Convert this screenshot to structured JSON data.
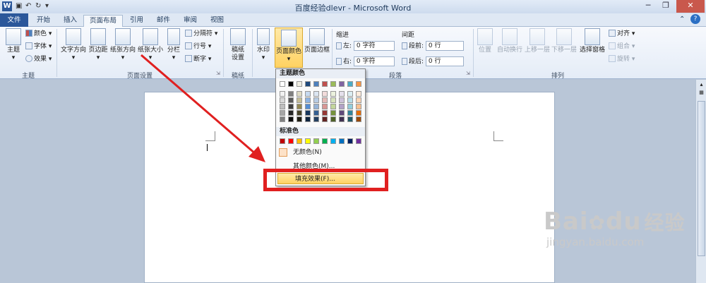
{
  "window": {
    "app_icon": "W",
    "title": "百度经验dlevr - Microsoft Word",
    "controls": [
      "─",
      "❐",
      "✕"
    ]
  },
  "tabs": [
    "文件",
    "开始",
    "插入",
    "页面布局",
    "引用",
    "邮件",
    "审阅",
    "视图"
  ],
  "ribbon": {
    "theme_group": {
      "label": "主题",
      "big": "主题",
      "small": [
        "颜色",
        "字体",
        "效果"
      ]
    },
    "page_setup": {
      "label": "页面设置",
      "big": [
        "文字方向",
        "页边距",
        "纸张方向",
        "纸张大小",
        "分栏"
      ],
      "small": [
        "分隔符",
        "行号",
        "断字"
      ]
    },
    "manuscript": {
      "label": "稿纸",
      "big": "稿纸\n设置",
      "line1": "稿纸",
      "line2": "设置"
    },
    "page_bg": {
      "watermark": "水印",
      "page_color": "页面颜色",
      "page_border": "页面边框"
    },
    "paragraph": {
      "label": "段落",
      "indent": "缩进",
      "spacing": "间距",
      "left": "左:",
      "left_val": "0 字符",
      "right": "右:",
      "right_val": "0 字符",
      "before": "段前:",
      "before_val": "0 行",
      "after": "段后:",
      "after_val": "0 行"
    },
    "arrange": {
      "label": "排列",
      "big": [
        "位置",
        "自动换行",
        "上移一层",
        "下移一层",
        "选择窗格"
      ],
      "small": [
        "对齐",
        "组合",
        "旋转"
      ]
    }
  },
  "dropdown": {
    "theme_colors_header": "主题颜色",
    "standard_colors_header": "标准色",
    "no_color": "无颜色(N)",
    "more_colors": "其他颜色(M)...",
    "fill_effects": "填充效果(F)...",
    "theme_top_row": [
      "#ffffff",
      "#000000",
      "#eeece1",
      "#1f497d",
      "#4f81bd",
      "#c0504d",
      "#9bbb59",
      "#8064a2",
      "#4bacc6",
      "#f79646"
    ],
    "theme_columns": [
      [
        "#f2f2f2",
        "#d9d9d9",
        "#bfbfbf",
        "#a6a6a6",
        "#808080"
      ],
      [
        "#7f7f7f",
        "#595959",
        "#3f3f3f",
        "#262626",
        "#0d0d0d"
      ],
      [
        "#ddd9c3",
        "#c4bd97",
        "#938953",
        "#494429",
        "#1d1b10"
      ],
      [
        "#c6d9f0",
        "#8db3e2",
        "#548dd4",
        "#17365d",
        "#0f243e"
      ],
      [
        "#dbe5f1",
        "#b8cce4",
        "#95b3d7",
        "#366092",
        "#244061"
      ],
      [
        "#f2dcdb",
        "#e5b9b7",
        "#d99694",
        "#953734",
        "#632423"
      ],
      [
        "#ebf1dd",
        "#d7e3bc",
        "#c3d69b",
        "#76923c",
        "#4f6128"
      ],
      [
        "#e5e0ec",
        "#ccc1d9",
        "#b2a2c7",
        "#5f497a",
        "#3f3151"
      ],
      [
        "#dbeef3",
        "#b7dde8",
        "#92cddc",
        "#31859b",
        "#205867"
      ],
      [
        "#fdeada",
        "#fbd5b5",
        "#fac08f",
        "#e36c09",
        "#974806"
      ]
    ],
    "standard": [
      "#c00000",
      "#ff0000",
      "#ffc000",
      "#ffff00",
      "#92d050",
      "#00b050",
      "#00b0f0",
      "#0070c0",
      "#002060",
      "#7030a0"
    ]
  },
  "accent_color": "#2b579a",
  "annotation_color": "#e02020",
  "watermark": {
    "logo": "Bai",
    "logo2": "du",
    "brand": "经验",
    "url": "jingyan.baidu.com"
  }
}
